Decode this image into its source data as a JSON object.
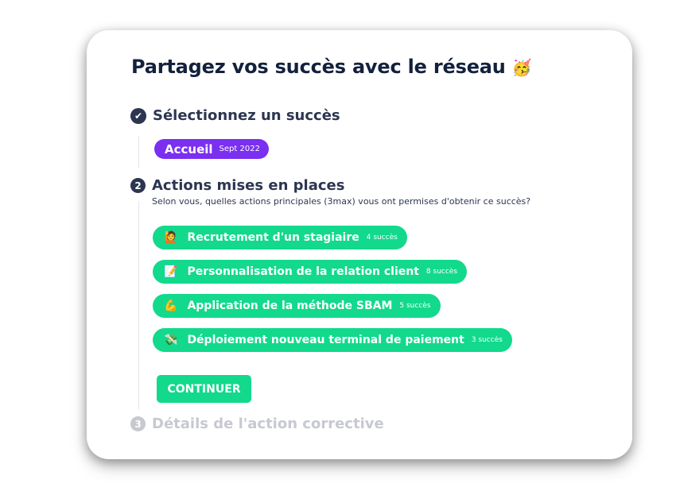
{
  "title": "Partagez vos succès avec le réseau",
  "title_emoji": "🥳",
  "colors": {
    "primary_green": "#12d98c",
    "purple": "#7b2ff0",
    "navy": "#14213d",
    "muted": "#c7c9d0"
  },
  "steps": [
    {
      "marker": "check-circle-icon",
      "label": "Sélectionnez un succès",
      "selected": {
        "label": "Accueil",
        "date": "Sept 2022"
      }
    },
    {
      "number": "2",
      "label": "Actions mises en places",
      "description": "Selon vous, quelles actions principales (3max) vous ont permises d'obtenir ce succès?",
      "actions": [
        {
          "emoji": "🙋",
          "label": "Recrutement d'un stagiaire",
          "count": "4 succès"
        },
        {
          "emoji": "📝",
          "label": "Personnalisation de la relation client",
          "count": "8 succès"
        },
        {
          "emoji": "💪",
          "label": "Application de la méthode SBAM",
          "count": "5 succès"
        },
        {
          "emoji": "💸",
          "label": "Déploiement nouveau terminal de paiement",
          "count": "3 succès"
        }
      ],
      "continue_label": "CONTINUER"
    },
    {
      "number": "3",
      "label": "Détails de l'action corrective"
    }
  ]
}
